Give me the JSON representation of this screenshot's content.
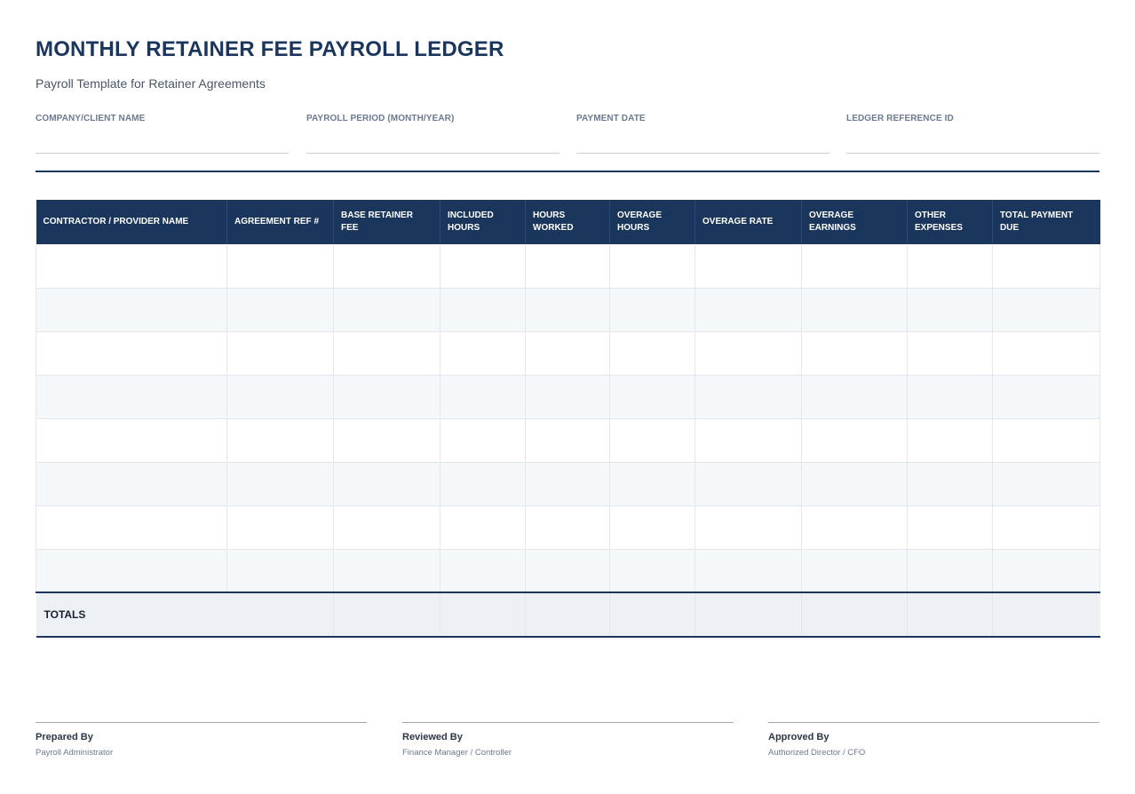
{
  "document": {
    "title": "MONTHLY RETAINER FEE PAYROLL LEDGER",
    "subtitle": "Payroll Template for Retainer Agreements"
  },
  "fields": [
    {
      "label": "COMPANY/CLIENT NAME",
      "value": ""
    },
    {
      "label": "PAYROLL PERIOD (MONTH/YEAR)",
      "value": ""
    },
    {
      "label": "PAYMENT DATE",
      "value": ""
    },
    {
      "label": "LEDGER REFERENCE ID",
      "value": ""
    }
  ],
  "table": {
    "columns": [
      "CONTRACTOR / PROVIDER NAME",
      "AGREEMENT REF #",
      "BASE RETAINER FEE",
      "INCLUDED HOURS",
      "HOURS WORKED",
      "OVERAGE HOURS",
      "OVERAGE RATE",
      "OVERAGE EARNINGS",
      "OTHER EXPENSES",
      "TOTAL PAYMENT DUE"
    ],
    "rows": [
      [
        "",
        "",
        "",
        "",
        "",
        "",
        "",
        "",
        "",
        ""
      ],
      [
        "",
        "",
        "",
        "",
        "",
        "",
        "",
        "",
        "",
        ""
      ],
      [
        "",
        "",
        "",
        "",
        "",
        "",
        "",
        "",
        "",
        ""
      ],
      [
        "",
        "",
        "",
        "",
        "",
        "",
        "",
        "",
        "",
        ""
      ],
      [
        "",
        "",
        "",
        "",
        "",
        "",
        "",
        "",
        "",
        ""
      ],
      [
        "",
        "",
        "",
        "",
        "",
        "",
        "",
        "",
        "",
        ""
      ],
      [
        "",
        "",
        "",
        "",
        "",
        "",
        "",
        "",
        "",
        ""
      ],
      [
        "",
        "",
        "",
        "",
        "",
        "",
        "",
        "",
        "",
        ""
      ]
    ],
    "totals_label": "TOTALS"
  },
  "signatures": [
    {
      "role": "Prepared By",
      "title": "Payroll Administrator"
    },
    {
      "role": "Reviewed By",
      "title": "Finance Manager / Controller"
    },
    {
      "role": "Approved By",
      "title": "Authorized Director / CFO"
    }
  ],
  "colors": {
    "primary": "#1b365d",
    "alt_row": "#f5f8fb",
    "totals_row": "#edf1f5"
  }
}
